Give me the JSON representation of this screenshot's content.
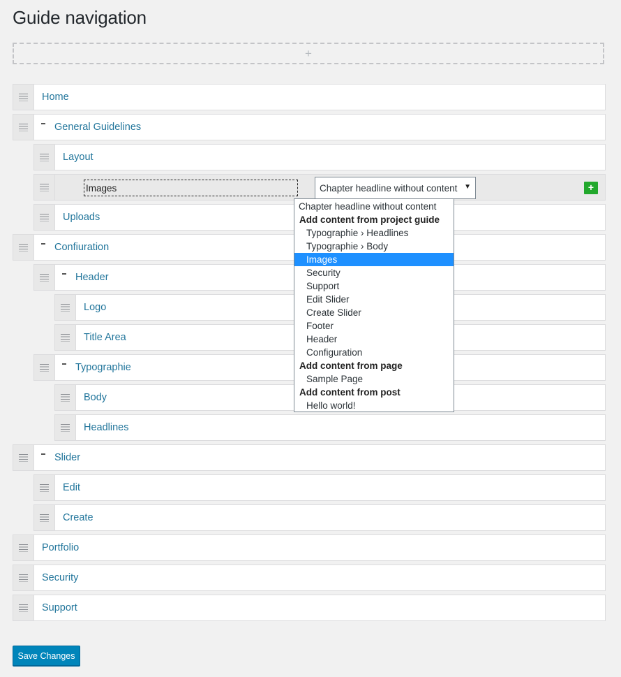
{
  "page": {
    "title": "Guide navigation",
    "add_zone_label": "+",
    "save_label": "Save Changes"
  },
  "items": [
    {
      "label": "Home",
      "level": 0,
      "toggle": false
    },
    {
      "label": "General Guidelines",
      "level": 0,
      "toggle": true
    },
    {
      "label": "Layout",
      "level": 1,
      "toggle": false
    },
    {
      "label": "Images",
      "level": 1,
      "toggle": false,
      "editing": true
    },
    {
      "label": "Uploads",
      "level": 1,
      "toggle": false
    },
    {
      "label": "Confiuration",
      "level": 0,
      "toggle": true
    },
    {
      "label": "Header",
      "level": 1,
      "toggle": true
    },
    {
      "label": "Logo",
      "level": 2,
      "toggle": false
    },
    {
      "label": "Title Area",
      "level": 2,
      "toggle": false
    },
    {
      "label": "Typographie",
      "level": 1,
      "toggle": true
    },
    {
      "label": "Body",
      "level": 2,
      "toggle": false
    },
    {
      "label": "Headlines",
      "level": 2,
      "toggle": false
    },
    {
      "label": "Slider",
      "level": 0,
      "toggle": true
    },
    {
      "label": "Edit",
      "level": 1,
      "toggle": false
    },
    {
      "label": "Create",
      "level": 1,
      "toggle": false
    },
    {
      "label": "Portfolio",
      "level": 0,
      "toggle": false
    },
    {
      "label": "Security",
      "level": 0,
      "toggle": false
    },
    {
      "label": "Support",
      "level": 0,
      "toggle": false
    }
  ],
  "editor": {
    "title_value": "Images",
    "select_value": "Chapter headline without content",
    "select_arrow": "▼",
    "add_button_label": "+"
  },
  "dropdown": [
    {
      "label": "Chapter headline without content",
      "kind": "top"
    },
    {
      "label": "Add content from project guide",
      "kind": "group"
    },
    {
      "label": "Typographie › Headlines",
      "kind": "option"
    },
    {
      "label": "Typographie › Body",
      "kind": "option"
    },
    {
      "label": "Images",
      "kind": "option",
      "selected": true
    },
    {
      "label": "Security",
      "kind": "option"
    },
    {
      "label": "Support",
      "kind": "option"
    },
    {
      "label": "Edit Slider",
      "kind": "option"
    },
    {
      "label": "Create Slider",
      "kind": "option"
    },
    {
      "label": "Footer",
      "kind": "option"
    },
    {
      "label": "Header",
      "kind": "option"
    },
    {
      "label": "Configuration",
      "kind": "option"
    },
    {
      "label": "Add content from page",
      "kind": "group"
    },
    {
      "label": "Sample Page",
      "kind": "option"
    },
    {
      "label": "Add content from post",
      "kind": "group"
    },
    {
      "label": "Hello world!",
      "kind": "option"
    }
  ],
  "colors": {
    "link": "#21759b",
    "primary_button": "#0085ba",
    "add_button": "#22a82c",
    "selected_option": "#1e90ff"
  }
}
